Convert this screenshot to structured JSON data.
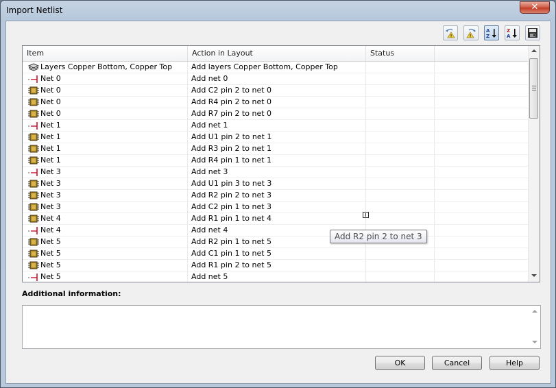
{
  "window": {
    "title": "Import Netlist",
    "close_glyph": "✕"
  },
  "toolbar": [
    {
      "name": "toolbar-prev-warning-button",
      "icon": "prev-warning-icon"
    },
    {
      "name": "toolbar-next-warning-button",
      "icon": "next-warning-icon"
    },
    {
      "name": "toolbar-sort-ascending-button",
      "icon": "sort-ascending-icon"
    },
    {
      "name": "toolbar-sort-descending-button",
      "icon": "sort-descending-icon"
    },
    {
      "name": "toolbar-save-report-button",
      "icon": "save-report-icon"
    }
  ],
  "table": {
    "columns": [
      "Item",
      "Action in Layout",
      "Status"
    ],
    "rows": [
      {
        "icon": "layers-icon",
        "item": "Layers Copper Bottom, Copper Top",
        "action": "Add layers Copper Bottom, Copper Top",
        "status": ""
      },
      {
        "icon": "net-icon",
        "item": "Net 0",
        "action": "Add net 0",
        "status": ""
      },
      {
        "icon": "pin-icon",
        "item": "Net 0",
        "action": "Add C2 pin 2 to net 0",
        "status": ""
      },
      {
        "icon": "pin-icon",
        "item": "Net 0",
        "action": "Add R4 pin 2 to net 0",
        "status": ""
      },
      {
        "icon": "pin-icon",
        "item": "Net 0",
        "action": "Add R7 pin 2 to net 0",
        "status": ""
      },
      {
        "icon": "net-icon",
        "item": "Net 1",
        "action": "Add net 1",
        "status": ""
      },
      {
        "icon": "pin-icon",
        "item": "Net 1",
        "action": "Add U1 pin 2 to net 1",
        "status": ""
      },
      {
        "icon": "pin-icon",
        "item": "Net 1",
        "action": "Add R3 pin 2 to net 1",
        "status": ""
      },
      {
        "icon": "pin-icon",
        "item": "Net 1",
        "action": "Add R4 pin 1 to net 1",
        "status": ""
      },
      {
        "icon": "net-icon",
        "item": "Net 3",
        "action": "Add net 3",
        "status": ""
      },
      {
        "icon": "pin-icon",
        "item": "Net 3",
        "action": "Add U1 pin 3 to net 3",
        "status": ""
      },
      {
        "icon": "pin-icon",
        "item": "Net 3",
        "action": "Add R2 pin 2 to net 3",
        "status": ""
      },
      {
        "icon": "pin-icon",
        "item": "Net 3",
        "action": "Add C2 pin 1 to net 3",
        "status": ""
      },
      {
        "icon": "pin-icon",
        "item": "Net 4",
        "action": "Add R1 pin 1 to net 4",
        "status": ""
      },
      {
        "icon": "net-icon",
        "item": "Net 4",
        "action": "Add net 4",
        "status": ""
      },
      {
        "icon": "pin-icon",
        "item": "Net 5",
        "action": "Add R2 pin 1 to net 5",
        "status": ""
      },
      {
        "icon": "pin-icon",
        "item": "Net 5",
        "action": "Add C1 pin 1 to net 5",
        "status": ""
      },
      {
        "icon": "pin-icon",
        "item": "Net 5",
        "action": "Add R1 pin 2 to net 5",
        "status": ""
      },
      {
        "icon": "net-icon",
        "item": "Net 5",
        "action": "Add net 5",
        "status": ""
      }
    ]
  },
  "tooltip": {
    "text": "Add R2 pin 2 to net 3"
  },
  "additional_info": {
    "label": "Additional information:",
    "text": ""
  },
  "buttons": {
    "ok": "OK",
    "cancel": "Cancel",
    "help": "Help"
  },
  "colors": {
    "net_red": "#c8102e",
    "pin_gold": "#b08a2a",
    "title_bg": "#b7c8dc",
    "close_red": "#c33f28"
  }
}
